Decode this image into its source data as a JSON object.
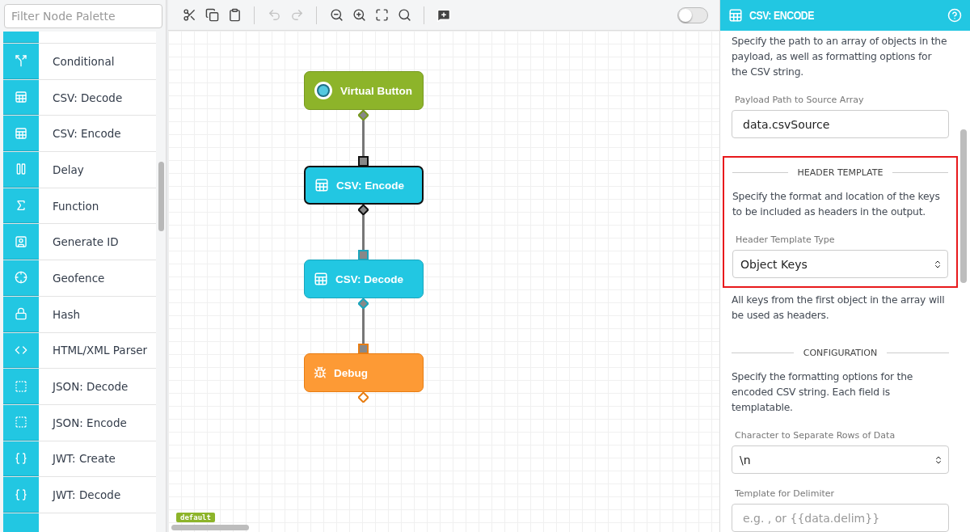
{
  "palette": {
    "search": {
      "placeholder": "Filter Node Palette"
    },
    "items": [
      {
        "kind": "cut"
      },
      {
        "label": "Conditional"
      },
      {
        "label": "CSV: Decode"
      },
      {
        "label": "CSV: Encode"
      },
      {
        "label": "Delay"
      },
      {
        "label": "Function"
      },
      {
        "label": "Generate ID"
      },
      {
        "label": "Geofence"
      },
      {
        "label": "Hash"
      },
      {
        "label": "HTML/XML Parser"
      },
      {
        "label": "JSON: Decode"
      },
      {
        "label": "JSON: Encode"
      },
      {
        "label": "JWT: Create"
      },
      {
        "label": "JWT: Decode"
      },
      {
        "kind": "cut"
      }
    ]
  },
  "toolbar": {
    "undo_disabled": true,
    "redo_disabled": true,
    "debug_toggle": {
      "on": false
    }
  },
  "canvas": {
    "nodes": [
      {
        "label": "Virtual Button",
        "kind": "trigger",
        "selected": false
      },
      {
        "label": "CSV: Encode",
        "kind": "action",
        "selected": true
      },
      {
        "label": "CSV: Decode",
        "kind": "action",
        "selected": false
      },
      {
        "label": "Debug",
        "kind": "debug",
        "selected": false
      }
    ],
    "badge": "default"
  },
  "panel": {
    "title": "CSV: ENCODE",
    "intro": "Specify the path to an array of objects in the payload, as well as formatting options for the CSV string.",
    "sections": [
      {
        "kind": "field",
        "label": "Payload Path to Source Array",
        "value": "data.csvSource"
      },
      {
        "kind": "group",
        "heading": "HEADER TEMPLATE",
        "highlighted": true,
        "text": "Specify the format and location of the keys to be included as headers in the output.",
        "select_label": "Header Template Type",
        "select_value": "Object Keys"
      },
      {
        "kind": "note",
        "text": "All keys from the first object in the array will be used as headers."
      },
      {
        "kind": "heading",
        "heading": "CONFIGURATION",
        "text": "Specify the formatting options for the encoded CSV string. Each field is templatable."
      },
      {
        "kind": "select",
        "label": "Character to Separate Rows of Data",
        "value": "\\n"
      },
      {
        "kind": "field",
        "label": "Template for Delimiter",
        "placeholder": "e.g. , or {{data.delim}}"
      }
    ]
  }
}
